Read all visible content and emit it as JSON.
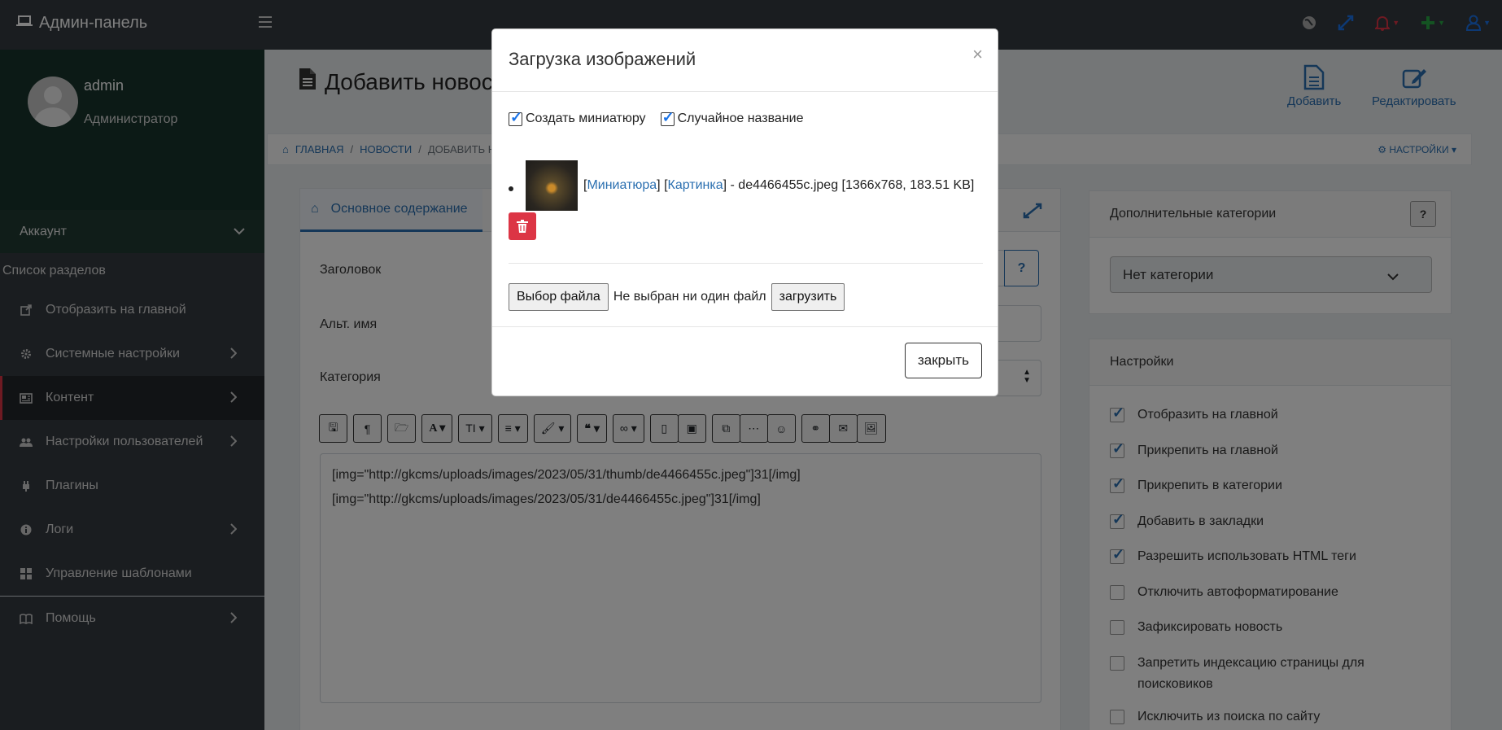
{
  "topbar": {
    "brand": "Админ-панель"
  },
  "sidebar": {
    "user_name": "admin",
    "user_role": "Администратор",
    "account_label": "Аккаунт",
    "section_title": "Список разделов",
    "items": [
      {
        "label": "Отобразить на главной"
      },
      {
        "label": "Системные настройки"
      },
      {
        "label": "Контент"
      },
      {
        "label": "Настройки пользователей"
      },
      {
        "label": "Плагины"
      },
      {
        "label": "Логи"
      },
      {
        "label": "Управление шаблонами"
      },
      {
        "label": "Помощь"
      }
    ]
  },
  "page": {
    "title": "Добавить новость",
    "add_label": "Добавить",
    "edit_label": "Редактировать"
  },
  "breadcrumb": {
    "home": "ГЛАВНАЯ",
    "news": "НОВОСТИ",
    "current": "ДОБАВИТЬ НОВОСТЬ",
    "settings": "НАСТРОЙКИ"
  },
  "main_card": {
    "tab_label": "Основное содержание",
    "title_label": "Заголовок",
    "alt_label": "Альт. имя",
    "category_label": "Категория",
    "help": "?",
    "editor_lines": [
      "[img=\"http://gkcms/uploads/images/2023/05/31/thumb/de4466455c.jpeg\"]31[/img]",
      "[img=\"http://gkcms/uploads/images/2023/05/31/de4466455c.jpeg\"]31[/img]"
    ]
  },
  "extra_categories": {
    "title": "Дополнительные категории",
    "help": "?",
    "selected": "Нет категории"
  },
  "settings_card": {
    "title": "Настройки",
    "options": [
      {
        "label": "Отобразить на главной",
        "checked": true
      },
      {
        "label": "Прикрепить на главной",
        "checked": true
      },
      {
        "label": "Прикрепить в категории",
        "checked": true
      },
      {
        "label": "Добавить в закладки",
        "checked": true
      },
      {
        "label": "Разрешить использовать HTML теги",
        "checked": true
      },
      {
        "label": "Отключить автоформатирование",
        "checked": false
      },
      {
        "label": "Зафиксировать новость",
        "checked": false
      },
      {
        "label": "Запретить индексацию страницы для поисковиков",
        "checked": false
      },
      {
        "label": "Исключить из поиска по сайту",
        "checked": false
      }
    ]
  },
  "modal": {
    "title": "Загрузка изображений",
    "close_x": "×",
    "create_thumb": "Создать миниатюру",
    "random_name": "Случайное название",
    "thumb_link": "Миниатюра",
    "image_link": "Картинка",
    "file_info": "] - de4466455c.jpeg [1366x768, 183.51 KB]",
    "choose_file": "Выбор файла",
    "no_file": "Не выбран ни один файл",
    "upload": "загрузить",
    "close": "закрыть"
  },
  "colors": {
    "accent": "#2a6fb0",
    "danger": "#dc3545",
    "sidebar": "#343a40"
  }
}
